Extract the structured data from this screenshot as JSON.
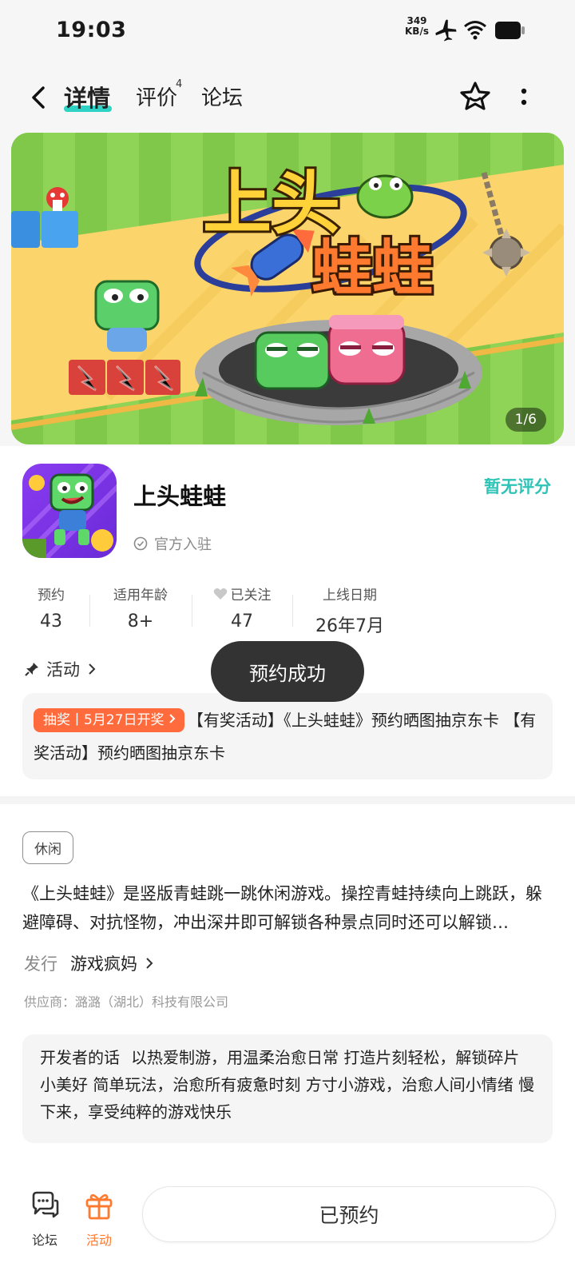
{
  "status_bar": {
    "time": "19:03",
    "net_speed_value": "349",
    "net_speed_unit": "KB/s",
    "icons": [
      "airplane-icon",
      "wifi-icon",
      "battery-icon"
    ]
  },
  "header": {
    "tabs": [
      {
        "label": "详情",
        "active": true
      },
      {
        "label": "评价",
        "badge": "4"
      },
      {
        "label": "论坛"
      }
    ],
    "icons": [
      "back-icon",
      "star-favorite-icon",
      "more-vertical-icon"
    ]
  },
  "banner": {
    "counter": "1/6",
    "logo_text_top": "上头",
    "logo_text_bottom": "蛙蛙"
  },
  "app": {
    "name": "上头蛙蛙",
    "official": "官方入驻",
    "rating": "暂无评分"
  },
  "stats": [
    {
      "label": "预约",
      "value": "43"
    },
    {
      "label": "适用年龄",
      "value": "8+"
    },
    {
      "label": "已关注",
      "value": "47"
    },
    {
      "label": "上线日期",
      "value": "26年7月"
    }
  ],
  "activity": {
    "section_label": "活动",
    "tag": "抽奖丨5月27日开奖",
    "text": "【有奖活动】《上头蛙蛙》预约晒图抽京东卡 【有奖活动】预约晒图抽京东卡"
  },
  "toast": "预约成功",
  "details": {
    "genre": "休闲",
    "description": "《上头蛙蛙》是竖版青蛙跳一跳休闲游戏。操控青蛙持续向上跳跃，躲避障碍、对抗怪物，冲出深井即可解锁各种景点同时还可以解锁…",
    "publisher_label": "发行",
    "publisher": "游戏疯妈",
    "supplier": "供应商：潞潞（湖北）科技有限公司",
    "dev_note_label": "开发者的话",
    "dev_note": "以热爱制游，用温柔治愈日常 打造片刻轻松，解锁碎片小美好 简单玩法，治愈所有疲惫时刻 方寸小游戏，治愈人间小情绪 慢下来，享受纯粹的游戏快乐"
  },
  "bottom_bar": {
    "forum_label": "论坛",
    "activity_label": "活动",
    "reserve_button": "已预约",
    "accent_color": "#ff7a2f"
  },
  "colors": {
    "tab_underline": "#2fd3c5",
    "rating": "#2dc3b7",
    "activity_tag": "#ff6b3d"
  }
}
